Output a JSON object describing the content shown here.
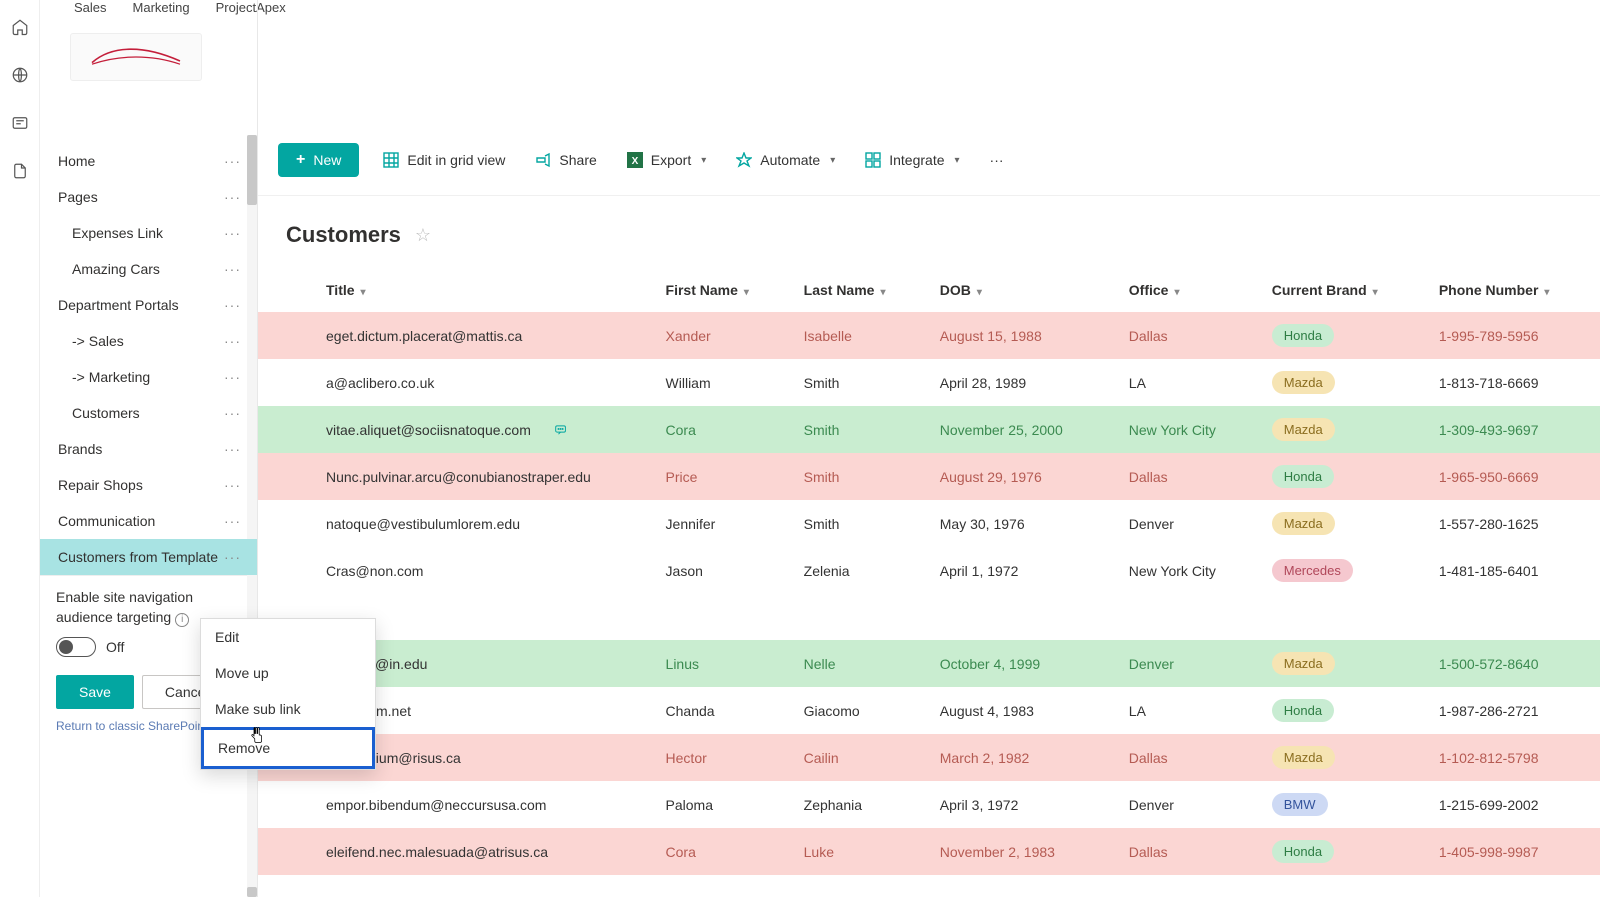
{
  "topTabs": {
    "t0": "Sales",
    "t1": "Marketing",
    "t2": "ProjectApex"
  },
  "sidebar": {
    "items": [
      {
        "label": "Home"
      },
      {
        "label": "Pages"
      },
      {
        "label": "Expenses Link"
      },
      {
        "label": "Amazing Cars"
      },
      {
        "label": "Department Portals"
      },
      {
        "label": "-> Sales"
      },
      {
        "label": "-> Marketing"
      },
      {
        "label": "Customers"
      },
      {
        "label": "Brands"
      },
      {
        "label": "Repair Shops"
      },
      {
        "label": "Communication"
      },
      {
        "label": "Customers from Template"
      }
    ],
    "audienceLabel": "Enable site navigation audience targeting",
    "toggleState": "Off",
    "saveLabel": "Save",
    "cancelLabel": "Cancel",
    "returnLabel": "Return to classic SharePoint"
  },
  "contextMenu": {
    "edit": "Edit",
    "moveUp": "Move up",
    "subLink": "Make sub link",
    "remove": "Remove"
  },
  "toolbar": {
    "newLabel": "New",
    "editGrid": "Edit in grid view",
    "share": "Share",
    "export": "Export",
    "automate": "Automate",
    "integrate": "Integrate"
  },
  "list": {
    "title": "Customers",
    "columns": {
      "title": "Title",
      "first": "First Name",
      "last": "Last Name",
      "dob": "DOB",
      "office": "Office",
      "brand": "Current Brand",
      "phone": "Phone Number"
    },
    "rows": [
      {
        "rowClass": "row-red",
        "title": "eget.dictum.placerat@mattis.ca",
        "first": "Xander",
        "last": "Isabelle",
        "dob": "August 15, 1988",
        "office": "Dallas",
        "brand": "Honda",
        "phone": "1-995-789-5956"
      },
      {
        "rowClass": "row-plain",
        "title": "a@aclibero.co.uk",
        "first": "William",
        "last": "Smith",
        "dob": "April 28, 1989",
        "office": "LA",
        "brand": "Mazda",
        "phone": "1-813-718-6669"
      },
      {
        "rowClass": "row-green",
        "title": "vitae.aliquet@sociisnatoque.com",
        "first": "Cora",
        "last": "Smith",
        "dob": "November 25, 2000",
        "office": "New York City",
        "brand": "Mazda",
        "phone": "1-309-493-9697",
        "hasComment": true
      },
      {
        "rowClass": "row-red",
        "title": "Nunc.pulvinar.arcu@conubianostraper.edu",
        "first": "Price",
        "last": "Smith",
        "dob": "August 29, 1976",
        "office": "Dallas",
        "brand": "Honda",
        "phone": "1-965-950-6669"
      },
      {
        "rowClass": "row-plain",
        "title": "natoque@vestibulumlorem.edu",
        "first": "Jennifer",
        "last": "Smith",
        "dob": "May 30, 1976",
        "office": "Denver",
        "brand": "Mazda",
        "phone": "1-557-280-1625"
      },
      {
        "rowClass": "row-plain",
        "title": "Cras@non.com",
        "first": "Jason",
        "last": "Zelenia",
        "dob": "April 1, 1972",
        "office": "New York City",
        "brand": "Mercedes",
        "phone": "1-481-185-6401"
      },
      {
        "rowClass": "spacer"
      },
      {
        "rowClass": "row-green",
        "title": "egestas@in.edu",
        "first": "Linus",
        "last": "Nelle",
        "dob": "October 4, 1999",
        "office": "Denver",
        "brand": "Mazda",
        "phone": "1-500-572-8640"
      },
      {
        "rowClass": "row-plain",
        "title": "m@Etiam.net",
        "first": "Chanda",
        "last": "Giacomo",
        "dob": "August 4, 1983",
        "office": "LA",
        "brand": "Honda",
        "phone": "1-987-286-2721"
      },
      {
        "rowClass": "row-red",
        "title": ".elit.pretium@risus.ca",
        "first": "Hector",
        "last": "Cailin",
        "dob": "March 2, 1982",
        "office": "Dallas",
        "brand": "Mazda",
        "phone": "1-102-812-5798"
      },
      {
        "rowClass": "row-plain",
        "title": "empor.bibendum@neccursusa.com",
        "first": "Paloma",
        "last": "Zephania",
        "dob": "April 3, 1972",
        "office": "Denver",
        "brand": "BMW",
        "phone": "1-215-699-2002"
      },
      {
        "rowClass": "row-red",
        "title": "eleifend.nec.malesuada@atrisus.ca",
        "first": "Cora",
        "last": "Luke",
        "dob": "November 2, 1983",
        "office": "Dallas",
        "brand": "Honda",
        "phone": "1-405-998-9987"
      }
    ]
  }
}
